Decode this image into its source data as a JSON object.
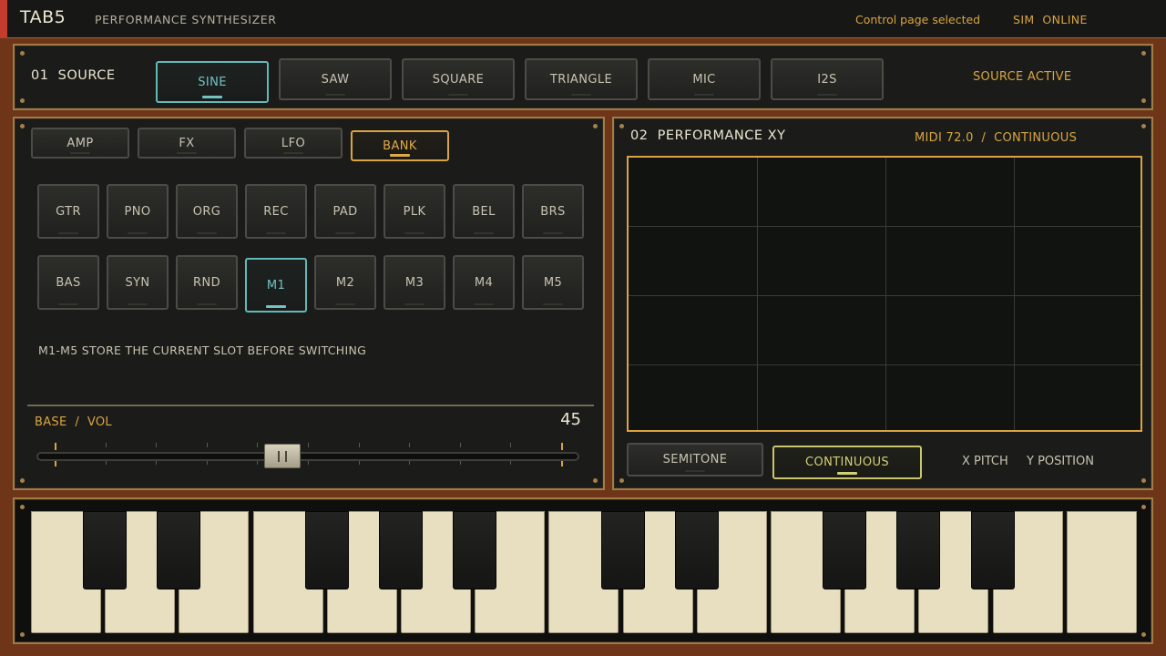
{
  "app": {
    "title": "TAB5",
    "subtitle": "PERFORMANCE SYNTHESIZER",
    "status": "Control page selected",
    "sim_status": "SIM  ONLINE"
  },
  "source": {
    "label": "01  SOURCE",
    "buttons": [
      "SINE",
      "SAW",
      "SQUARE",
      "TRIANGLE",
      "MIC",
      "I2S"
    ],
    "selected": "SINE",
    "state": "SOURCE ACTIVE"
  },
  "control": {
    "tabs": [
      "AMP",
      "FX",
      "LFO",
      "BANK"
    ],
    "selected_tab": "BANK",
    "bank_row1": [
      "GTR",
      "PNO",
      "ORG",
      "REC",
      "PAD",
      "PLK",
      "BEL",
      "BRS"
    ],
    "bank_row2": [
      "BAS",
      "SYN",
      "RND",
      "M1",
      "M2",
      "M3",
      "M4",
      "M5"
    ],
    "selected_slot": "M1",
    "hint": "M1-M5 STORE THE CURRENT SLOT BEFORE SWITCHING",
    "slider_label": "BASE  /  VOL",
    "slider_value": "45",
    "slider_fraction": 0.45
  },
  "performance": {
    "label": "02  PERFORMANCE XY",
    "midi_status": "MIDI 72.0  /  CONTINUOUS",
    "modes": [
      "SEMITONE",
      "CONTINUOUS"
    ],
    "selected_mode": "CONTINUOUS",
    "x_axis": "X PITCH",
    "y_axis": "Y POSITION"
  },
  "colors": {
    "accent_amber": "#d9a441",
    "accent_cyan": "#74c3c3",
    "accent_olive": "#d3cf76",
    "wood": "#6e3519",
    "panel": "#1b1c19"
  },
  "keyboard": {
    "white_keys": 15,
    "black_keys": 10
  }
}
